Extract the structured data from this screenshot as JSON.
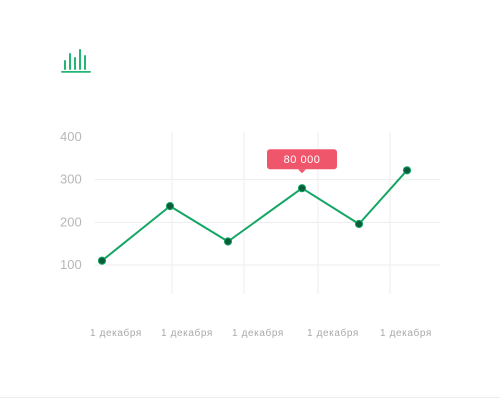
{
  "colors": {
    "line": "#15a565",
    "point": "#0b5c3b",
    "tooltip_bg": "#f0566b",
    "grid": "#ededed",
    "icon": "#22b573"
  },
  "icons": {
    "app": "bar-chart-icon"
  },
  "chart_data": {
    "type": "line",
    "title": "",
    "xlabel": "",
    "ylabel": "",
    "ylim": [
      50,
      420
    ],
    "y_ticks": [
      {
        "value": 100,
        "label": "100"
      },
      {
        "value": 200,
        "label": "200"
      },
      {
        "value": 300,
        "label": "300"
      },
      {
        "value": 400,
        "label": "400"
      }
    ],
    "x_tick_labels": [
      "1 декабря",
      "1 декабря",
      "1 декабря",
      "1 декабря",
      "1 декабря"
    ],
    "series": [
      {
        "values": [
          110,
          238,
          155,
          280,
          196,
          322
        ]
      }
    ],
    "tooltip": {
      "point_index": 3,
      "label": "80 000"
    },
    "grid": true,
    "legend": "none"
  }
}
